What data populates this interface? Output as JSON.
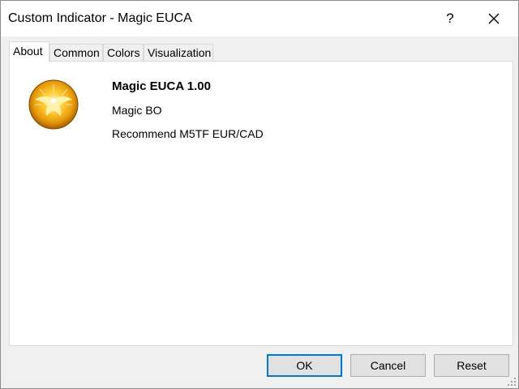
{
  "window": {
    "title": "Custom Indicator - Magic EUCA",
    "help_label": "?",
    "icons": {
      "help": "question-mark-icon",
      "close": "close-icon",
      "grip": "resize-grip-icon"
    }
  },
  "tabs": [
    {
      "label": "About",
      "active": true
    },
    {
      "label": "Common",
      "active": false
    },
    {
      "label": "Colors",
      "active": false
    },
    {
      "label": "Visualization",
      "active": false
    }
  ],
  "about": {
    "logo_icon": "golden-eagle-logo",
    "name": "Magic EUCA 1.00",
    "author": "Magic BO",
    "description": "Recommend M5TF EUR/CAD"
  },
  "buttons": {
    "ok": "OK",
    "cancel": "Cancel",
    "reset": "Reset"
  },
  "colors": {
    "title_bg": "#ffffff",
    "dialog_bg": "#f0f0f0",
    "panel_bg": "#ffffff",
    "accent": "#0078d7",
    "logo_gold": "#f2b705"
  }
}
